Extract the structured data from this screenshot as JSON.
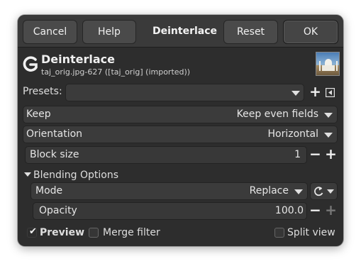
{
  "header": {
    "cancel_label": "Cancel",
    "help_label": "Help",
    "title": "Deinterlace",
    "reset_label": "Reset",
    "ok_label": "OK"
  },
  "operation": {
    "title": "Deinterlace",
    "subtitle": "taj_orig.jpg-627 ([taj_orig] (imported))"
  },
  "presets": {
    "label": "Presets:",
    "value": ""
  },
  "keep": {
    "label": "Keep",
    "value": "Keep even fields"
  },
  "orientation": {
    "label": "Orientation",
    "value": "Horizontal"
  },
  "block_size": {
    "label": "Block size",
    "value": "1"
  },
  "blending": {
    "section_label": "Blending Options",
    "mode_label": "Mode",
    "mode_value": "Replace",
    "opacity_label": "Opacity",
    "opacity_value": "100.0"
  },
  "footer": {
    "preview_label": "Preview",
    "preview_checked": true,
    "merge_label": "Merge filter",
    "merge_checked": false,
    "split_label": "Split view",
    "split_checked": false
  },
  "icons": {
    "plus": "+",
    "minus": "−"
  }
}
